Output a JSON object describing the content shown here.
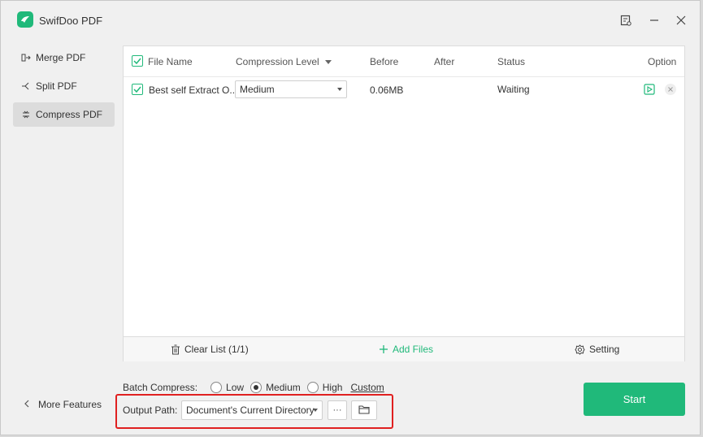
{
  "app": {
    "title": "SwifDoo PDF"
  },
  "sidebar": {
    "items": [
      {
        "label": "Merge PDF",
        "icon": "merge-icon",
        "active": false
      },
      {
        "label": "Split PDF",
        "icon": "split-icon",
        "active": false
      },
      {
        "label": "Compress PDF",
        "icon": "compress-icon",
        "active": true
      }
    ],
    "more_features": "More Features"
  },
  "table": {
    "columns": {
      "file_name": "File Name",
      "compression_level": "Compression Level",
      "before": "Before",
      "after": "After",
      "status": "Status",
      "option": "Option"
    },
    "rows": [
      {
        "file_name": "Best self Extract O...",
        "compression_level": "Medium",
        "before": "0.06MB",
        "after": "",
        "status": "Waiting"
      }
    ]
  },
  "footer": {
    "clear_list": "Clear List (1/1)",
    "add_files": "Add Files",
    "setting": "Setting"
  },
  "batch": {
    "label": "Batch Compress:",
    "options": [
      "Low",
      "Medium",
      "High"
    ],
    "selected": "Medium",
    "custom": "Custom"
  },
  "output": {
    "label": "Output Path:",
    "value": "Document's Current Directory",
    "more_label": "···"
  },
  "start_label": "Start",
  "colors": {
    "accent": "#20b97a",
    "highlight": "#e02020"
  }
}
